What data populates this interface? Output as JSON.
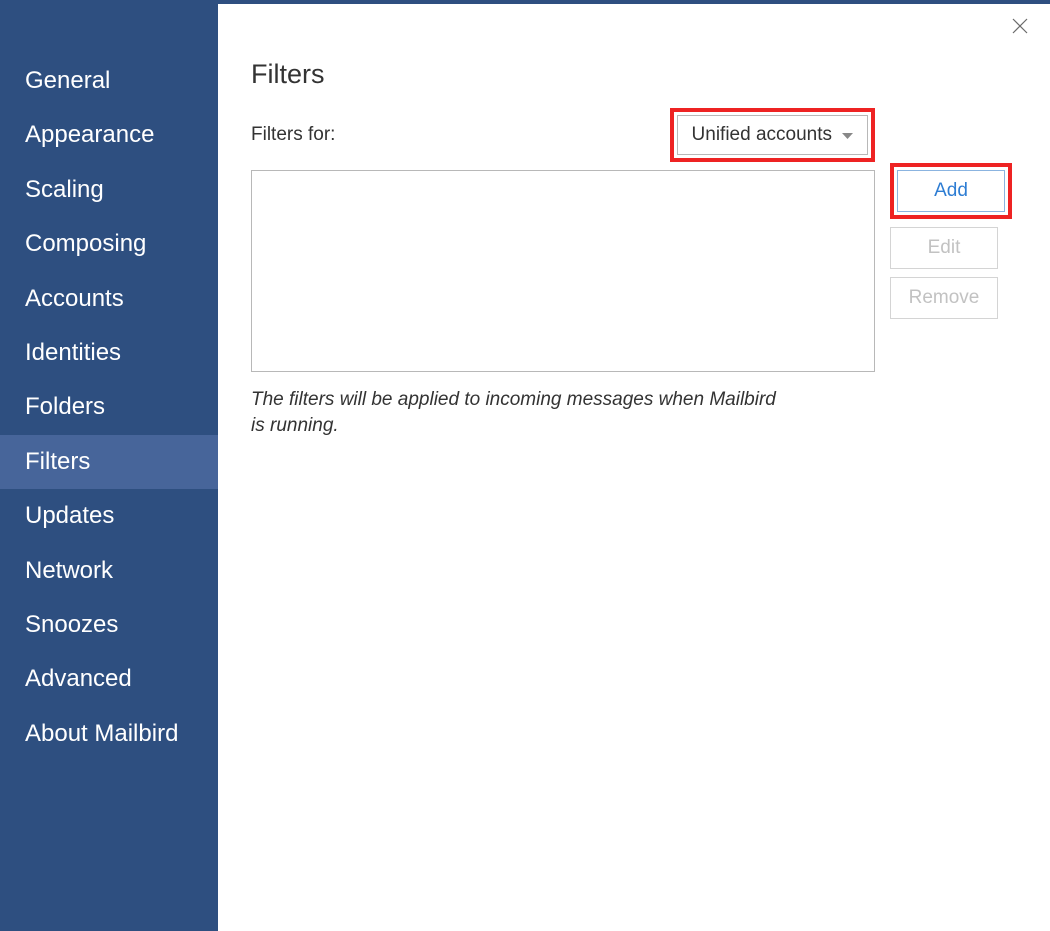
{
  "sidebar": {
    "items": [
      {
        "label": "General",
        "active": false
      },
      {
        "label": "Appearance",
        "active": false
      },
      {
        "label": "Scaling",
        "active": false
      },
      {
        "label": "Composing",
        "active": false
      },
      {
        "label": "Accounts",
        "active": false
      },
      {
        "label": "Identities",
        "active": false
      },
      {
        "label": "Folders",
        "active": false
      },
      {
        "label": "Filters",
        "active": true
      },
      {
        "label": "Updates",
        "active": false
      },
      {
        "label": "Network",
        "active": false
      },
      {
        "label": "Snoozes",
        "active": false
      },
      {
        "label": "Advanced",
        "active": false
      },
      {
        "label": "About Mailbird",
        "active": false
      }
    ]
  },
  "main": {
    "title": "Filters",
    "filters_for_label": "Filters for:",
    "dropdown_selected": "Unified accounts",
    "buttons": {
      "add": "Add",
      "edit": "Edit",
      "remove": "Remove"
    },
    "explain": "The filters will be applied to incoming messages when Mailbird is running."
  }
}
